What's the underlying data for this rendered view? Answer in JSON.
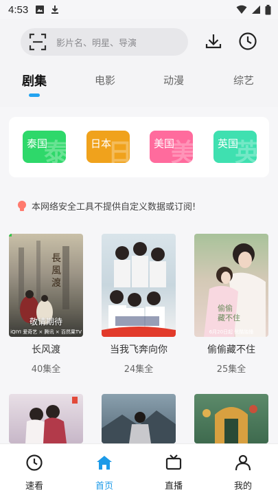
{
  "status_bar": {
    "time": "4:53"
  },
  "search": {
    "placeholder": "影片名、明星、导演"
  },
  "tabs": [
    {
      "label": "剧集",
      "active": true
    },
    {
      "label": "电影",
      "active": false
    },
    {
      "label": "动漫",
      "active": false
    },
    {
      "label": "综艺",
      "active": false
    }
  ],
  "categories": [
    {
      "label": "泰国",
      "watermark": "泰",
      "color": "#2ed86a"
    },
    {
      "label": "日本",
      "watermark": "日",
      "color": "#f0a21c"
    },
    {
      "label": "美国",
      "watermark": "美",
      "color": "#ff6b9d"
    },
    {
      "label": "英国",
      "watermark": "英",
      "color": "#3fe0b0"
    }
  ],
  "notice": "本网络安全工具不提供自定义数据或订阅!",
  "shows": [
    {
      "title": "长风渡",
      "episodes": "40集全",
      "poster_tag": "敬请期待",
      "poster_sub": "iQIYI 爱奇艺 × 腾讯 × 百然果TV"
    },
    {
      "title": "当我飞奔向你",
      "episodes": "24集全",
      "poster_tag": "",
      "poster_sub": ""
    },
    {
      "title": "偷偷藏不住",
      "episodes": "25集全",
      "poster_tag": "",
      "poster_sub": "6月20日起 优酷独播"
    }
  ],
  "bottom_nav": [
    {
      "label": "速看",
      "icon": "clock-icon",
      "active": false
    },
    {
      "label": "首页",
      "icon": "home-icon",
      "active": true
    },
    {
      "label": "直播",
      "icon": "tv-icon",
      "active": false
    },
    {
      "label": "我的",
      "icon": "person-icon",
      "active": false
    }
  ],
  "colors": {
    "accent": "#1c9ae8",
    "indicator": "#23a3f0"
  }
}
